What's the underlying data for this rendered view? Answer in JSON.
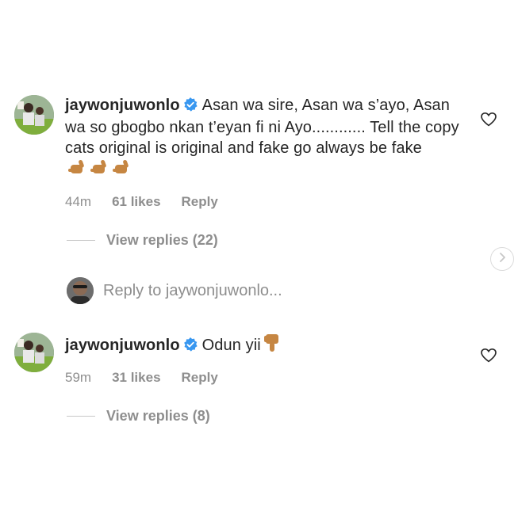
{
  "comments": [
    {
      "username": "jaywonjuwonlo",
      "text": "Asan wa sire, Asan wa s’ayo, Asan wa so gbogbo nkan t’eyan fi ni Ayo............ Tell the copy cats original is original and fake go always be fake",
      "emoji": "call-me-hand-icon",
      "time": "44m",
      "likes": "61 likes",
      "reply_label": "Reply",
      "view_replies": "View replies (22)"
    },
    {
      "username": "jaywonjuwonlo",
      "text": "Odun yii",
      "emoji": "pointing-down-icon",
      "time": "59m",
      "likes": "31 likes",
      "reply_label": "Reply",
      "view_replies": "View replies (8)"
    }
  ],
  "reply_box": {
    "placeholder": "Reply to jaywonjuwonlo..."
  },
  "colors": {
    "text": "#262626",
    "secondary": "#8e8e8e",
    "verified": "#3897f0",
    "emoji_skin": "#c68642"
  }
}
